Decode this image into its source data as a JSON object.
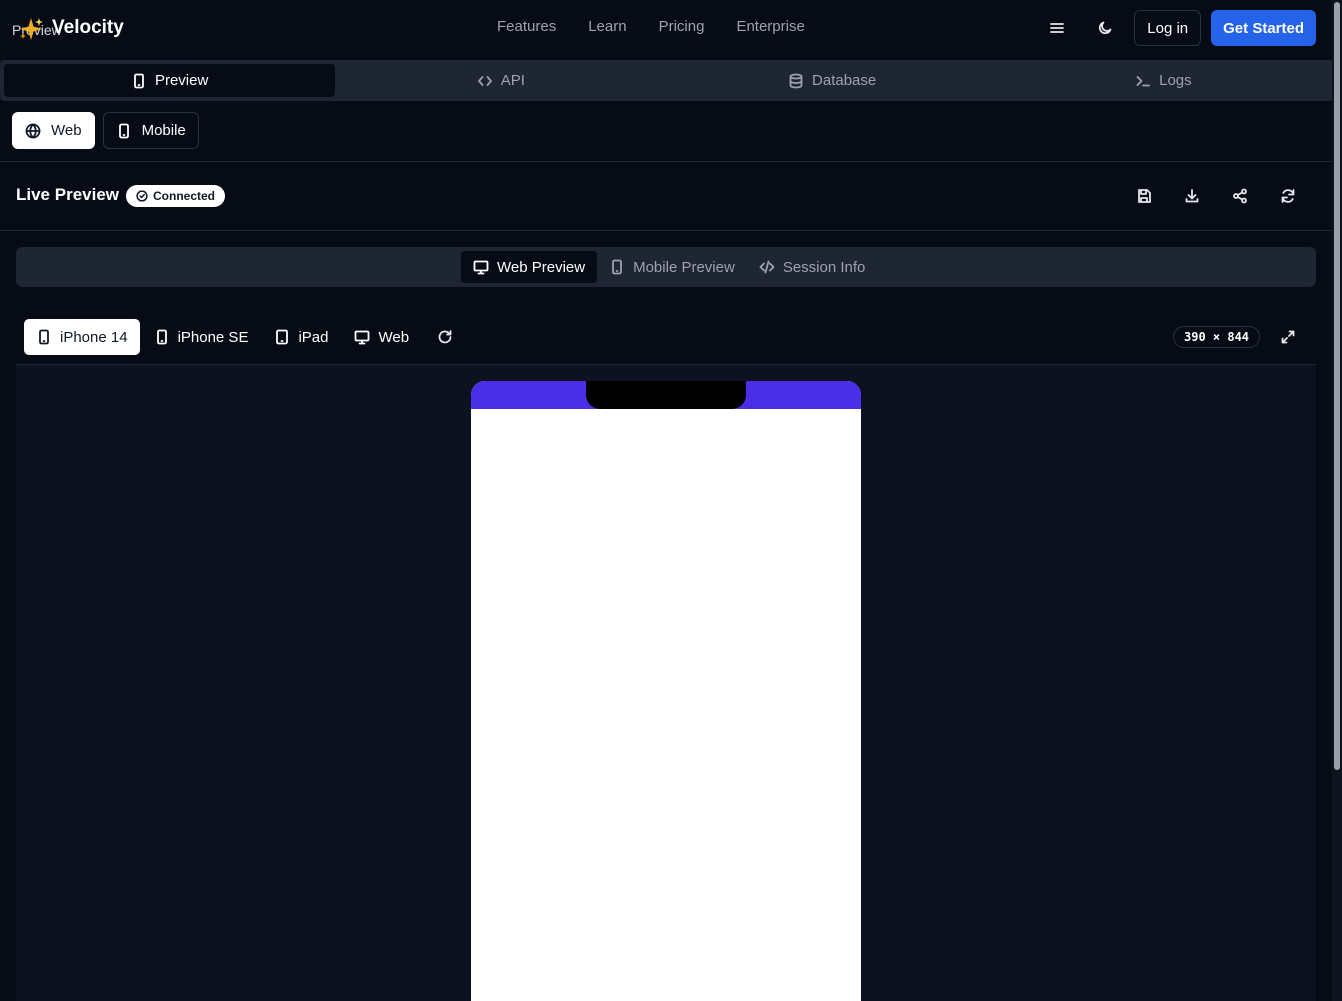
{
  "brand": {
    "ghost_text": "Preview",
    "name": "Velocity",
    "logo_icon": "sparkles-icon"
  },
  "nav": {
    "items": [
      "Features",
      "Learn",
      "Pricing",
      "Enterprise"
    ]
  },
  "header_actions": {
    "menu_icon": "menu-icon",
    "theme_icon": "moon-icon",
    "login": "Log in",
    "get_started": "Get Started"
  },
  "main_tabs": [
    {
      "label": "Preview",
      "icon": "smartphone-icon",
      "active": true
    },
    {
      "label": "API",
      "icon": "code-icon",
      "active": false
    },
    {
      "label": "Database",
      "icon": "database-icon",
      "active": false
    },
    {
      "label": "Logs",
      "icon": "terminal-icon",
      "active": false
    }
  ],
  "mode_toggle": {
    "web": "Web",
    "mobile": "Mobile",
    "selected": "Web"
  },
  "live_preview": {
    "title": "Live Preview",
    "status": "Connected"
  },
  "toolbar": {
    "icons": [
      "save-icon",
      "download-icon",
      "share-icon",
      "refresh-icon"
    ]
  },
  "sub_tabs": [
    {
      "label": "Web Preview",
      "icon": "monitor-icon",
      "active": true
    },
    {
      "label": "Mobile Preview",
      "icon": "smartphone-icon",
      "active": false
    },
    {
      "label": "Session Info",
      "icon": "code-icon",
      "active": false
    }
  ],
  "devices": [
    {
      "label": "iPhone 14",
      "icon": "smartphone-icon",
      "active": true
    },
    {
      "label": "iPhone SE",
      "icon": "smartphone-icon",
      "active": false
    },
    {
      "label": "iPad",
      "icon": "tablet-icon",
      "active": false
    },
    {
      "label": "Web",
      "icon": "monitor-icon",
      "active": false
    }
  ],
  "viewport": {
    "dimensions": "390 × 844"
  },
  "colors": {
    "accent": "#2563eb",
    "phone_header": "#4a2ee8",
    "background": "#070b16",
    "panel": "#1e2533"
  }
}
